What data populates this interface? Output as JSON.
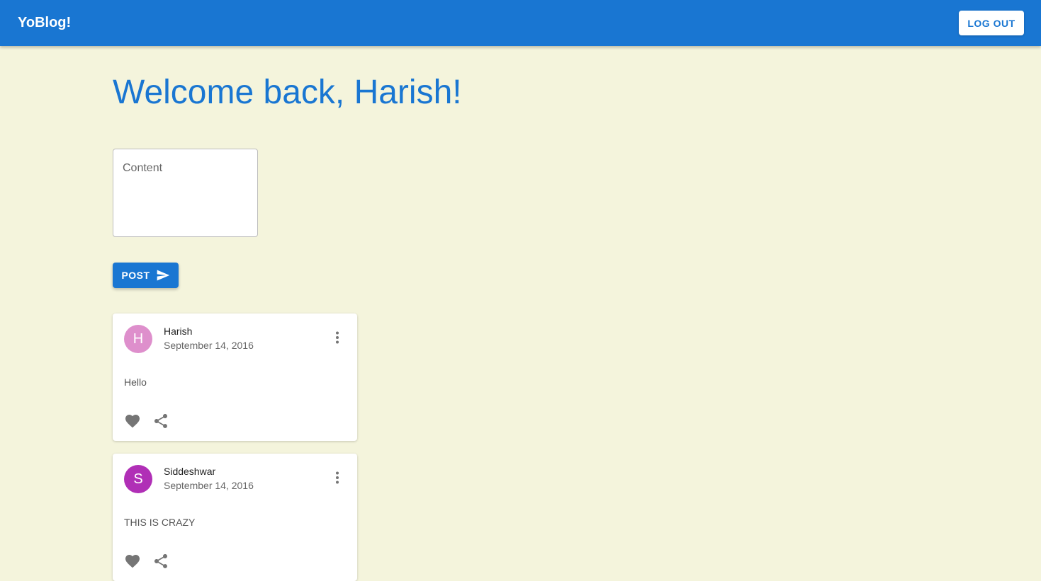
{
  "appbar": {
    "title": "YoBlog!",
    "logout_label": "LOG OUT"
  },
  "main": {
    "welcome": "Welcome back, Harish!",
    "content_placeholder": "Content",
    "post_label": "POST"
  },
  "posts": [
    {
      "avatar_letter": "H",
      "avatar_color": "#de8fcc",
      "author": "Harish",
      "date": "September 14, 2016",
      "body": "Hello"
    },
    {
      "avatar_letter": "S",
      "avatar_color": "#b02fb6",
      "author": "Siddeshwar",
      "date": "September 14, 2016",
      "body": "THIS IS CRAZY"
    }
  ],
  "colors": {
    "primary": "#1976d2",
    "background": "#f4f4dc",
    "icon": "#757575"
  },
  "icons": [
    "send-icon",
    "more-vert-icon",
    "heart-icon",
    "share-icon"
  ]
}
